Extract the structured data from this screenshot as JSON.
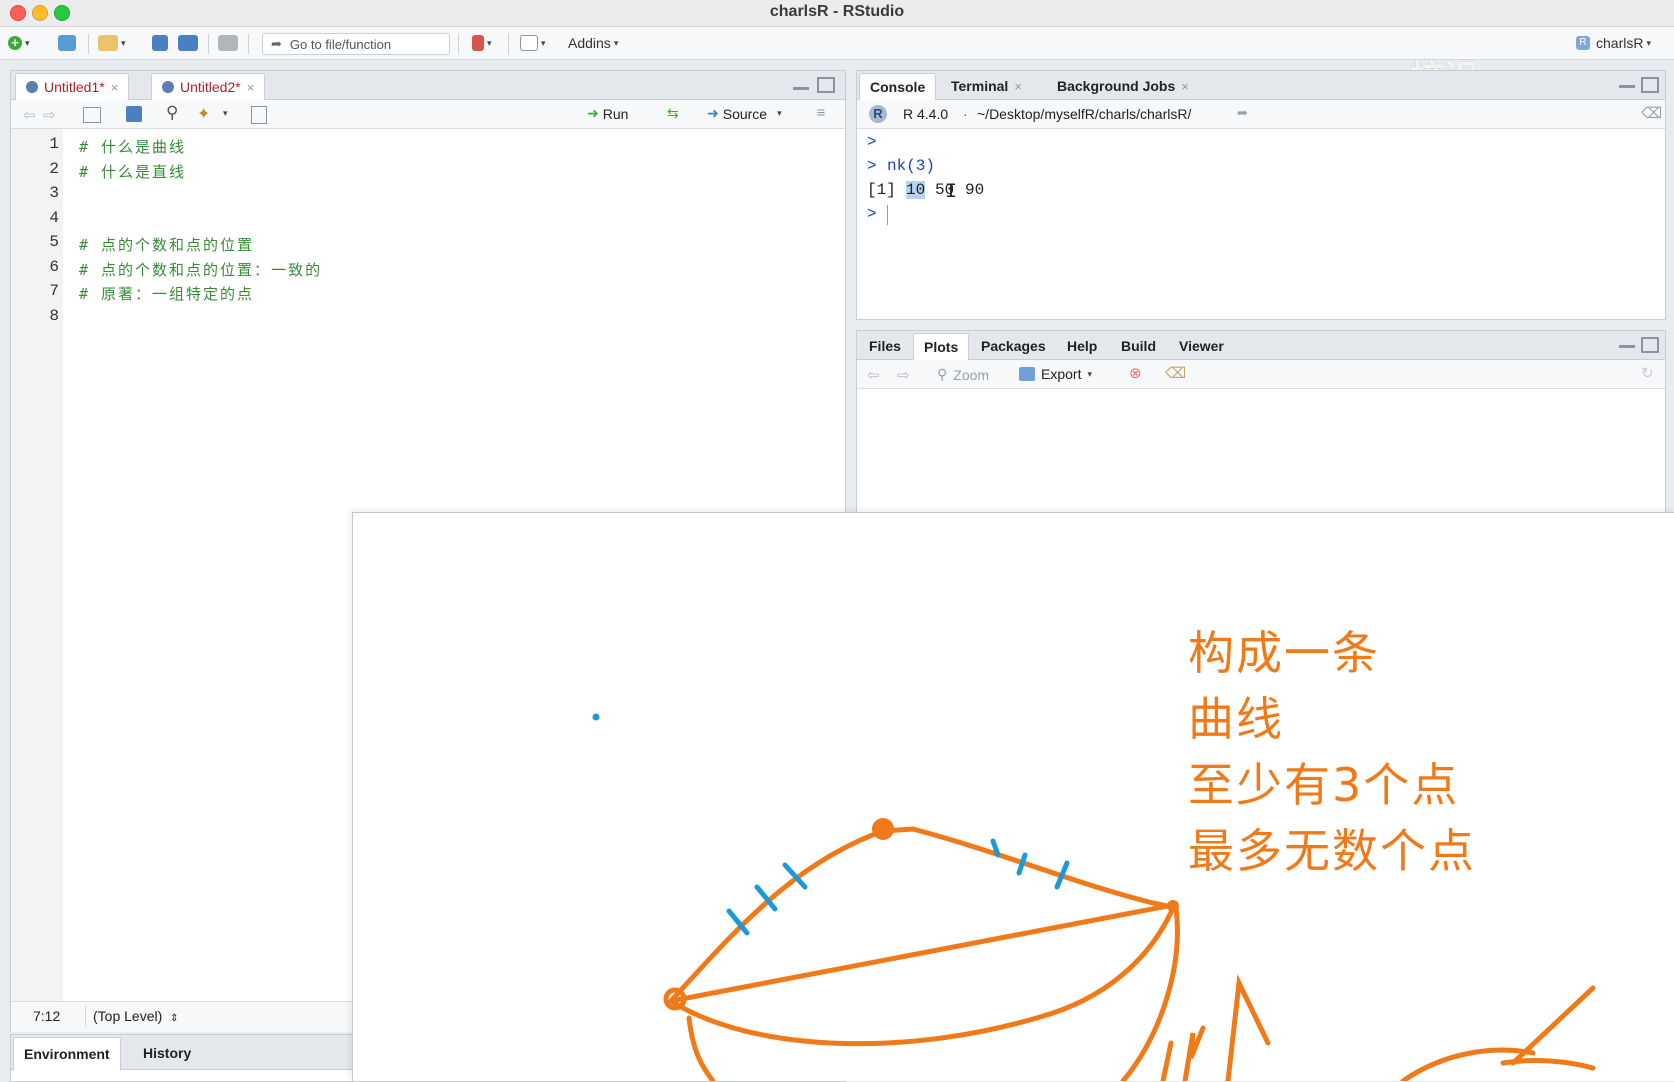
{
  "window": {
    "title": "charlsR - RStudio"
  },
  "toolbar": {
    "goto_label": "Go to file/function",
    "addins_label": "Addins",
    "project_label": "charlsR"
  },
  "watermark": "校识",
  "editor": {
    "tabs": [
      {
        "label": "Untitled1*"
      },
      {
        "label": "Untitled2*"
      }
    ],
    "run_label": "Run",
    "source_label": "Source",
    "line_numbers": [
      "1",
      "2",
      "3",
      "4",
      "5",
      "6",
      "7",
      "8"
    ],
    "lines": [
      "# 什么是曲线",
      "# 什么是直线",
      "",
      "",
      "# 点的个数和点的位置",
      "# 点的个数和点的位置：一致的",
      "# 原著：一组特定的点",
      ""
    ],
    "status_position": "7:12",
    "status_scope": "(Top Level)"
  },
  "env_tabs": [
    {
      "label": "Environment"
    },
    {
      "label": "History"
    }
  ],
  "console": {
    "tabs": [
      {
        "label": "Console"
      },
      {
        "label": "Terminal"
      },
      {
        "label": "Background Jobs"
      }
    ],
    "r_version": "R 4.4.0",
    "path": "~/Desktop/myselfR/charls/charlsR/",
    "prompt": ">",
    "command": "nk(3)",
    "output_index": "[1]",
    "output_values": [
      "10",
      "50",
      "90"
    ]
  },
  "files_pane": {
    "tabs": [
      {
        "label": "Files"
      },
      {
        "label": "Plots"
      },
      {
        "label": "Packages"
      },
      {
        "label": "Help"
      },
      {
        "label": "Build"
      },
      {
        "label": "Viewer"
      }
    ],
    "zoom_label": "Zoom",
    "export_label": "Export"
  },
  "whiteboard": {
    "notes": [
      "构成一条",
      "曲线",
      "至少有3个点",
      "最多无数个点"
    ],
    "stroke_color": "#f07a1a",
    "tick_color": "#1a9ad8"
  }
}
